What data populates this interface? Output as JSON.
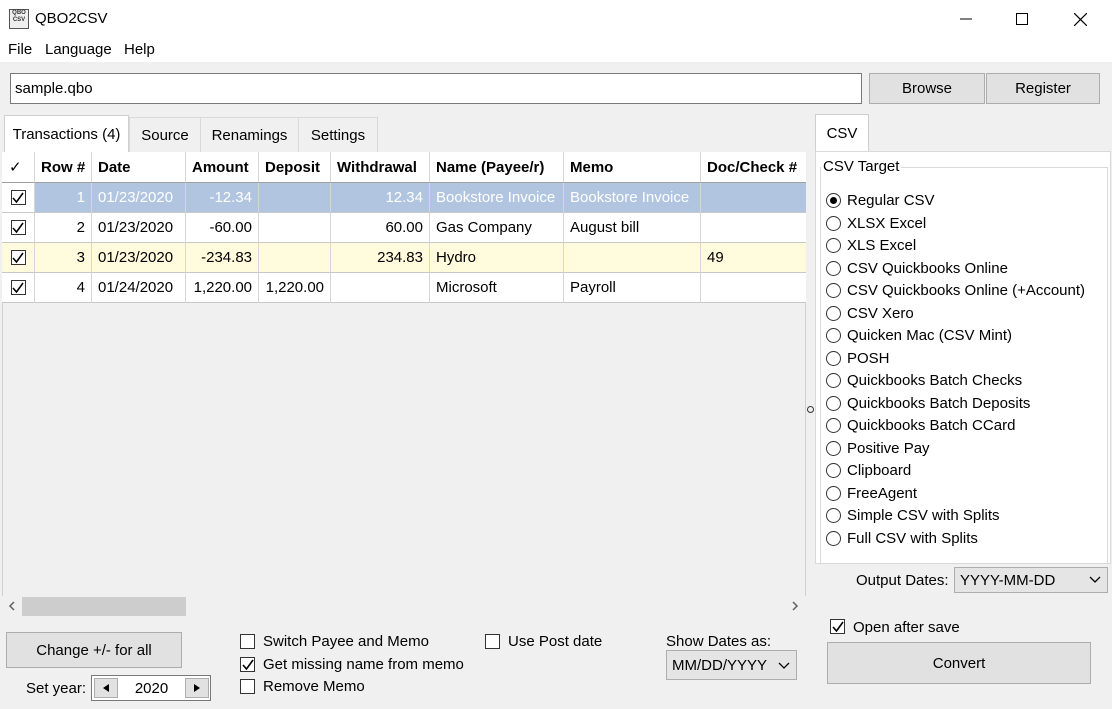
{
  "window": {
    "title": "QBO2CSV",
    "icon_text": "QBO CSV"
  },
  "menu": [
    "File",
    "Language",
    "Help"
  ],
  "file": {
    "value": "sample.qbo"
  },
  "buttons": {
    "browse": "Browse",
    "register": "Register",
    "change": "Change +/- for all",
    "convert": "Convert"
  },
  "tabs": [
    "Transactions (4)",
    "Source",
    "Renamings",
    "Settings"
  ],
  "right_tab": "CSV",
  "columns": [
    "✓",
    "Row #",
    "Date",
    "Amount",
    "Deposit",
    "Withdrawal",
    "Name (Payee/r)",
    "Memo",
    "Doc/Check #"
  ],
  "rows": [
    {
      "row": "1",
      "date": "01/23/2020",
      "amount": "-12.34",
      "deposit": "",
      "withdrawal": "12.34",
      "name": "Bookstore Invoice",
      "memo": "Bookstore Invoice",
      "doc": ""
    },
    {
      "row": "2",
      "date": "01/23/2020",
      "amount": "-60.00",
      "deposit": "",
      "withdrawal": "60.00",
      "name": "Gas Company",
      "memo": "August bill",
      "doc": ""
    },
    {
      "row": "3",
      "date": "01/23/2020",
      "amount": "-234.83",
      "deposit": "",
      "withdrawal": "234.83",
      "name": "Hydro",
      "memo": "",
      "doc": "49"
    },
    {
      "row": "4",
      "date": "01/24/2020",
      "amount": "1,220.00",
      "deposit": "1,220.00",
      "withdrawal": "",
      "name": "Microsoft",
      "memo": "Payroll",
      "doc": ""
    }
  ],
  "csv_target": {
    "title": "CSV Target",
    "selected": "Regular CSV",
    "options": [
      "Regular CSV",
      "XLSX Excel",
      "XLS Excel",
      "CSV Quickbooks Online",
      "CSV Quickbooks Online (+Account)",
      "CSV Xero",
      "Quicken Mac (CSV Mint)",
      "POSH",
      "Quickbooks Batch Checks",
      "Quickbooks Batch Deposits",
      "Quickbooks Batch CCard",
      "Positive Pay",
      "Clipboard",
      "FreeAgent",
      "Simple CSV with Splits",
      "Full CSV with Splits"
    ]
  },
  "output_dates": {
    "label": "Output Dates:",
    "value": "YYYY-MM-DD"
  },
  "open_after_save": {
    "label": "Open after save",
    "checked": true
  },
  "options": {
    "switch": {
      "label": "Switch Payee and Memo",
      "checked": false
    },
    "missing": {
      "label": "Get missing name from memo",
      "checked": true
    },
    "remove": {
      "label": "Remove Memo",
      "checked": false
    },
    "post": {
      "label": "Use Post date",
      "checked": false
    }
  },
  "show_dates": {
    "label": "Show Dates as:",
    "value": "MM/DD/YYYY"
  },
  "set_year": {
    "label": "Set year:",
    "value": "2020"
  },
  "colors": {
    "selected_row": "#b1c5e0",
    "highlight_row": "#fffbdc",
    "selected_text": "#ffffff"
  }
}
